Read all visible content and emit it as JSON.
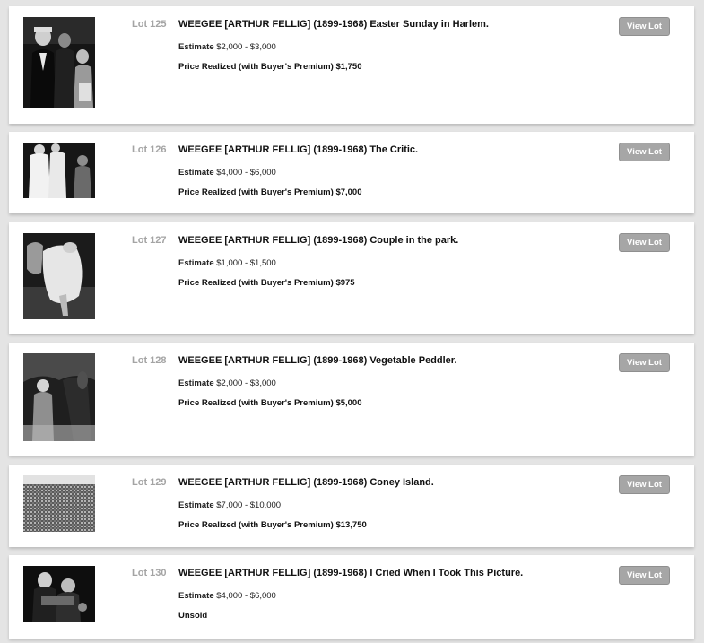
{
  "lots": [
    {
      "lot": "Lot 125",
      "title": "WEEGEE [ARTHUR FELLIG] (1899-1968) Easter Sunday in Harlem.",
      "estimate_label": "Estimate",
      "estimate_value": "$2,000 - $3,000",
      "price_label": "Price Realized (with Buyer's Premium)",
      "price_value": "$1,750",
      "button": "View Lot"
    },
    {
      "lot": "Lot 126",
      "title": "WEEGEE [ARTHUR FELLIG] (1899-1968) The Critic.",
      "estimate_label": "Estimate",
      "estimate_value": "$4,000 - $6,000",
      "price_label": "Price Realized (with Buyer's Premium)",
      "price_value": "$7,000",
      "button": "View Lot"
    },
    {
      "lot": "Lot 127",
      "title": "WEEGEE [ARTHUR FELLIG] (1899-1968) Couple in the park.",
      "estimate_label": "Estimate",
      "estimate_value": "$1,000 - $1,500",
      "price_label": "Price Realized (with Buyer's Premium)",
      "price_value": "$975",
      "button": "View Lot"
    },
    {
      "lot": "Lot 128",
      "title": "WEEGEE [ARTHUR FELLIG] (1899-1968) Vegetable Peddler.",
      "estimate_label": "Estimate",
      "estimate_value": "$2,000 - $3,000",
      "price_label": "Price Realized (with Buyer's Premium)",
      "price_value": "$5,000",
      "button": "View Lot"
    },
    {
      "lot": "Lot 129",
      "title": "WEEGEE [ARTHUR FELLIG] (1899-1968) Coney Island.",
      "estimate_label": "Estimate",
      "estimate_value": "$7,000 - $10,000",
      "price_label": "Price Realized (with Buyer's Premium)",
      "price_value": "$13,750",
      "button": "View Lot"
    },
    {
      "lot": "Lot 130",
      "title": "WEEGEE [ARTHUR FELLIG] (1899-1968) I Cried When I Took This Picture.",
      "estimate_label": "Estimate",
      "estimate_value": "$4,000 - $6,000",
      "price_label": "Unsold",
      "price_value": "",
      "button": "View Lot"
    }
  ]
}
